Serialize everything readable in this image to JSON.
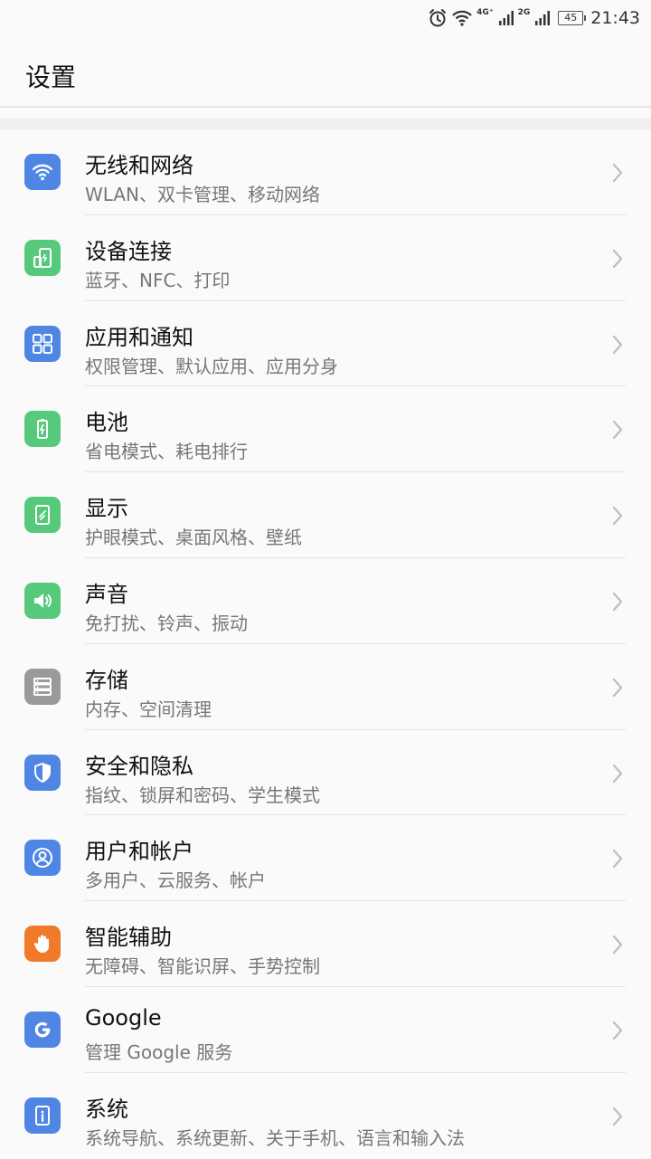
{
  "status_bar": {
    "icons": [
      "alarm-icon",
      "wifi-icon",
      "signal-icon",
      "signal-icon",
      "battery-icon"
    ],
    "net1_label": "4G⁺",
    "net2_label": "2G",
    "battery": "45",
    "time": "21:43"
  },
  "header": {
    "title": "设置"
  },
  "colors": {
    "blue": "#4f86e4",
    "green": "#56c97b",
    "gray": "#9a9a9a",
    "orange": "#f07a2a",
    "divider": "#e2e2e2",
    "chevron": "#bdbdbd"
  },
  "items": [
    {
      "title": "无线和网络",
      "subtitle": "WLAN、双卡管理、移动网络",
      "icon": "wifi-icon",
      "color": "blue"
    },
    {
      "title": "设备连接",
      "subtitle": "蓝牙、NFC、打印",
      "icon": "device-connection-icon",
      "color": "green"
    },
    {
      "title": "应用和通知",
      "subtitle": "权限管理、默认应用、应用分身",
      "icon": "apps-grid-icon",
      "color": "blue"
    },
    {
      "title": "电池",
      "subtitle": "省电模式、耗电排行",
      "icon": "battery-icon",
      "color": "green"
    },
    {
      "title": "显示",
      "subtitle": "护眼模式、桌面风格、壁纸",
      "icon": "display-icon",
      "color": "green"
    },
    {
      "title": "声音",
      "subtitle": "免打扰、铃声、振动",
      "icon": "speaker-icon",
      "color": "green"
    },
    {
      "title": "存储",
      "subtitle": "内存、空间清理",
      "icon": "storage-icon",
      "color": "gray"
    },
    {
      "title": "安全和隐私",
      "subtitle": "指纹、锁屏和密码、学生模式",
      "icon": "shield-icon",
      "color": "blue"
    },
    {
      "title": "用户和帐户",
      "subtitle": "多用户、云服务、帐户",
      "icon": "user-icon",
      "color": "blue"
    },
    {
      "title": "智能辅助",
      "subtitle": "无障碍、智能识屏、手势控制",
      "icon": "hand-icon",
      "color": "orange"
    },
    {
      "title": "Google",
      "subtitle": "管理 Google 服务",
      "icon": "google-icon",
      "color": "blue"
    },
    {
      "title": "系统",
      "subtitle": "系统导航、系统更新、关于手机、语言和输入法",
      "icon": "info-icon",
      "color": "blue"
    }
  ]
}
